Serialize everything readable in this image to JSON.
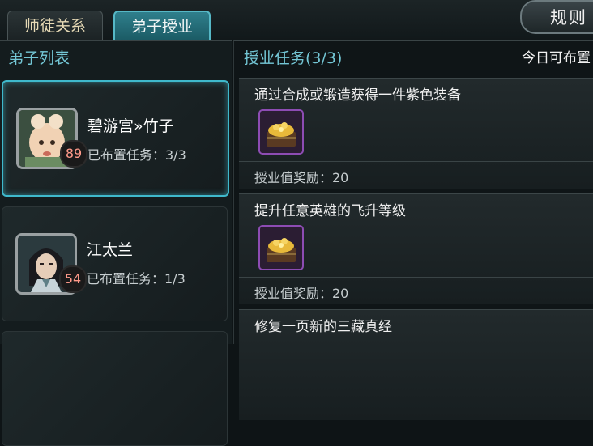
{
  "tabs": [
    {
      "label": "师徒关系",
      "active": false
    },
    {
      "label": "弟子授业",
      "active": true
    }
  ],
  "rules_button": {
    "label": "规则"
  },
  "student_list": {
    "title": "弟子列表",
    "items": [
      {
        "name": "碧游宫»竹子",
        "level": "89",
        "tasks": "已布置任务：3/3",
        "selected": true
      },
      {
        "name": "江太兰",
        "level": "54",
        "tasks": "已布置任务：1/3",
        "selected": false
      }
    ]
  },
  "tasks_panel": {
    "title": "授业任务(3/3)",
    "tip": "今日可布置",
    "tasks": [
      {
        "title": "通过合成或锻造获得一件紫色装备",
        "reward": "授业值奖励：20",
        "item_icon": "treasure-chest-icon"
      },
      {
        "title": "提升任意英雄的飞升等级",
        "reward": "授业值奖励：20",
        "item_icon": "treasure-chest-icon"
      },
      {
        "title": "修复一页新的三藏真经",
        "reward": "",
        "item_icon": ""
      }
    ]
  },
  "colors": {
    "accent": "#3fb9cc",
    "title": "#74c7d6",
    "level": "#ff9a8a",
    "item_border": "#8d4cb3"
  }
}
